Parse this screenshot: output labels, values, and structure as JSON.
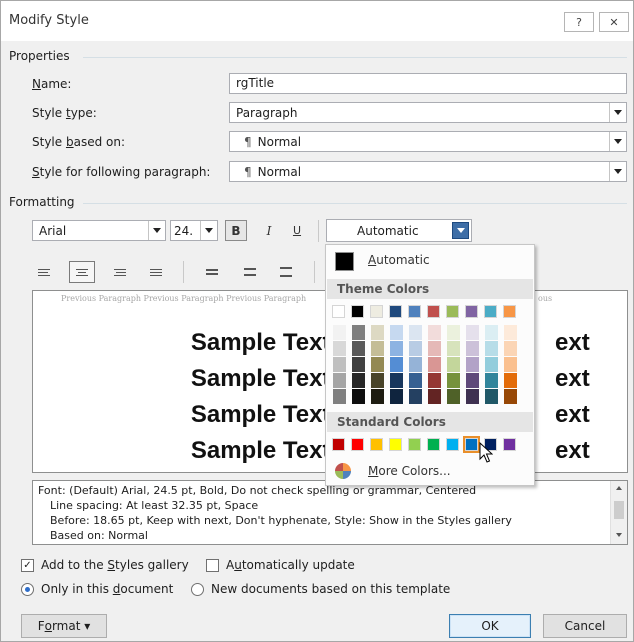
{
  "window": {
    "title": "Modify Style",
    "help_label": "?",
    "close_label": "✕"
  },
  "properties": {
    "header": "Properties",
    "name_label_pre": "",
    "name_label_acc": "N",
    "name_label_post": "ame:",
    "name_value": "rgTitle",
    "style_type_label_pre": "Style ",
    "style_type_label_acc": "t",
    "style_type_label_post": "ype:",
    "style_type_value": "Paragraph",
    "based_on_label_pre": "Style ",
    "based_on_label_acc": "b",
    "based_on_label_post": "ased on:",
    "based_on_mark": "¶",
    "based_on_value": "Normal",
    "following_label_pre": "",
    "following_label_acc": "S",
    "following_label_post": "tyle for following paragraph:",
    "following_mark": "¶",
    "following_value": "Normal"
  },
  "formatting": {
    "header": "Formatting",
    "font_name": "Arial",
    "font_size": "24.",
    "bold_label": "B",
    "italic_label": "I",
    "underline_label": "U",
    "color_value": "Automatic"
  },
  "preview": {
    "previous_paragraph": "Previous Paragraph Previous Paragraph Previous Paragraph",
    "previous_tail": "ous",
    "sample_lines": [
      {
        "left": "Sample Text Sampl",
        "right": "ext"
      },
      {
        "left": "Sample Text Sampl",
        "right": "ext"
      },
      {
        "left": "Sample Text Sampl",
        "right": "ext"
      },
      {
        "left": "Sample Text Sampl",
        "right": "ext"
      }
    ]
  },
  "description": {
    "line1": "Font: (Default) Arial, 24.5 pt, Bold, Do not check spelling or grammar, Centered",
    "line2": "Line spacing:  At least 32.35 pt, Space",
    "line3": "Before:  18.65 pt, Keep with next, Don't hyphenate, Style: Show in the Styles gallery",
    "line4": "Based on: Normal"
  },
  "options": {
    "add_gallery_pre": "Add to the ",
    "add_gallery_acc": "S",
    "add_gallery_post": "tyles gallery",
    "auto_update_pre": "A",
    "auto_update_acc": "u",
    "auto_update_post": "tomatically update",
    "only_doc_pre": "Only in this ",
    "only_doc_acc": "d",
    "only_doc_post": "ocument",
    "new_docs": "New documents based on this template"
  },
  "buttons": {
    "format_pre": "F",
    "format_acc": "o",
    "format_post": "rmat",
    "format_arrow": "▾",
    "ok": "OK",
    "cancel": "Cancel"
  },
  "color_menu": {
    "automatic_pre": "",
    "automatic_acc": "A",
    "automatic_post": "utomatic",
    "theme_header": "Theme Colors",
    "standard_header": "Standard Colors",
    "more_pre": "",
    "more_acc": "M",
    "more_post": "ore Colors...",
    "theme_top": [
      "#ffffff",
      "#000000",
      "#eeece1",
      "#1f497d",
      "#4f81bd",
      "#c0504d",
      "#9bbb59",
      "#8064a2",
      "#4bacc6",
      "#f79646"
    ],
    "theme_shades": [
      [
        "#f2f2f2",
        "#d8d8d8",
        "#bfbfbf",
        "#a5a5a5",
        "#7f7f7f"
      ],
      [
        "#7f7f7f",
        "#595959",
        "#3f3f3f",
        "#262626",
        "#0c0c0c"
      ],
      [
        "#ddd9c3",
        "#c4bd97",
        "#938953",
        "#494429",
        "#1d1b10"
      ],
      [
        "#c6d9f0",
        "#8db3e2",
        "#548dd4",
        "#17365d",
        "#0f243e"
      ],
      [
        "#dbe5f1",
        "#b8cce4",
        "#95b3d7",
        "#366092",
        "#244061"
      ],
      [
        "#f2dcdb",
        "#e5b9b7",
        "#d99694",
        "#953734",
        "#632423"
      ],
      [
        "#ebf1dd",
        "#d7e3bc",
        "#c3d69b",
        "#76923c",
        "#4f6128"
      ],
      [
        "#e5e0ec",
        "#ccc1d9",
        "#b2a2c7",
        "#5f497a",
        "#3f3151"
      ],
      [
        "#dbeef3",
        "#b7dde8",
        "#92cddc",
        "#31859b",
        "#205867"
      ],
      [
        "#fdeada",
        "#fbd5b5",
        "#fac08f",
        "#e36c09",
        "#974806"
      ]
    ],
    "standard": [
      "#c00000",
      "#ff0000",
      "#ffc000",
      "#ffff00",
      "#92d050",
      "#00b050",
      "#00b0f0",
      "#0070c0",
      "#002060",
      "#7030a0"
    ]
  }
}
